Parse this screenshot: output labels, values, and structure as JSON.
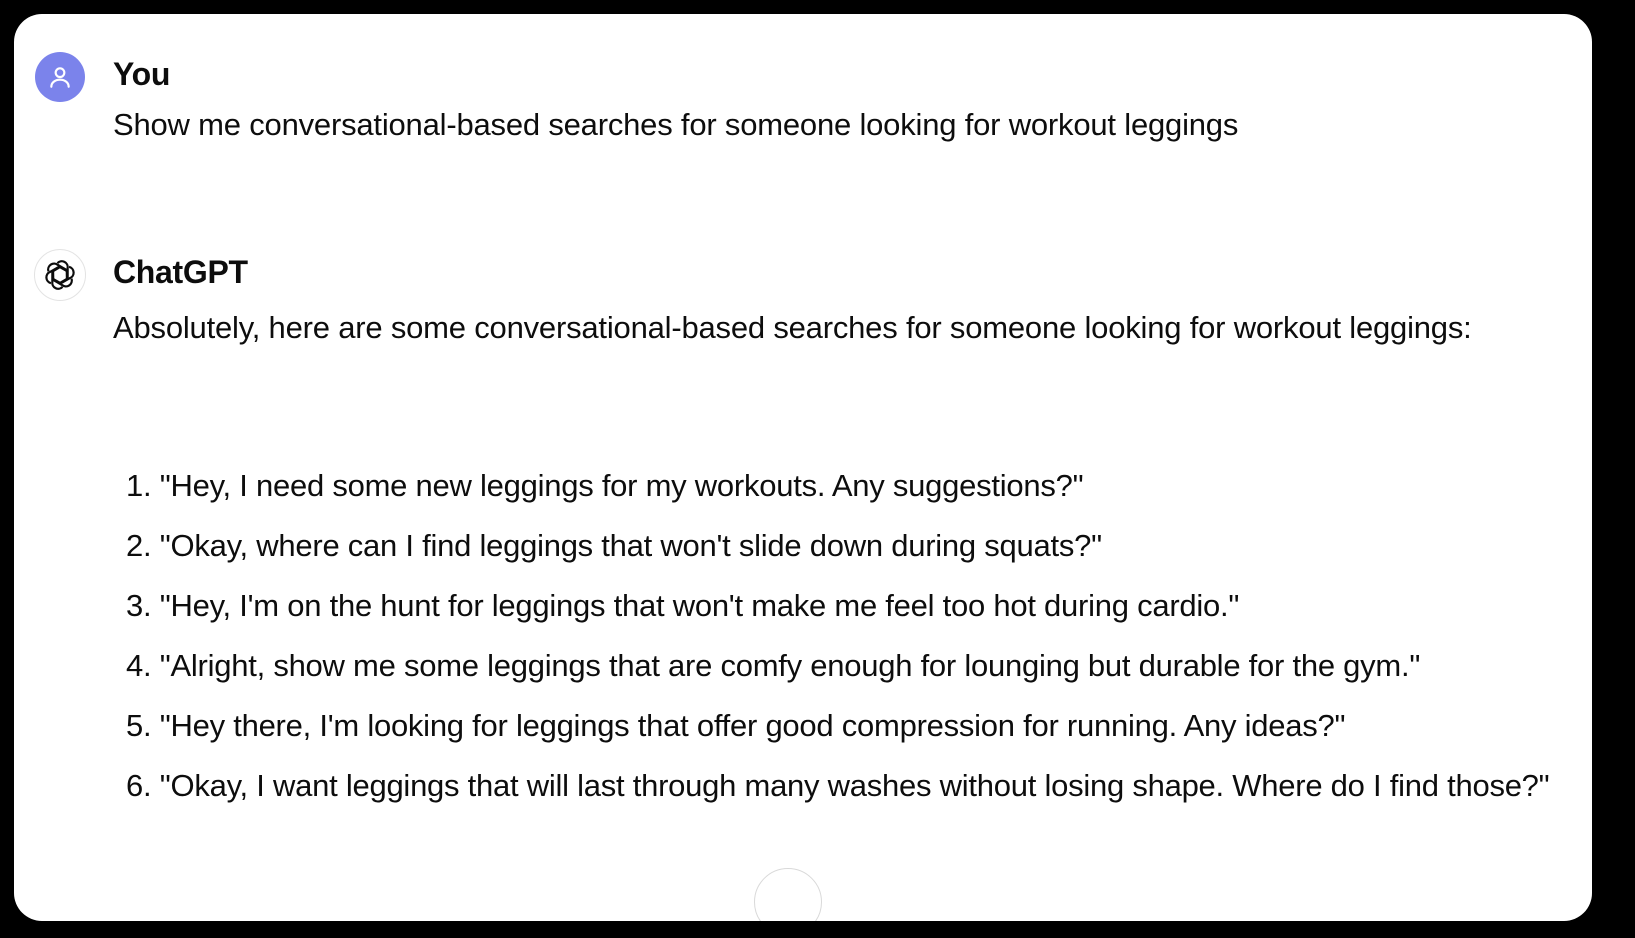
{
  "conversation": {
    "user": {
      "author": "You",
      "avatar_icon": "user-icon",
      "avatar_color": "#7b83eb",
      "message": "Show me conversational-based searches for someone looking for workout leggings"
    },
    "assistant": {
      "author": "ChatGPT",
      "avatar_icon": "openai-logo-icon",
      "intro": "Absolutely, here are some conversational-based searches for someone looking for workout leggings:",
      "items": [
        "1. \"Hey, I need some new leggings for my workouts. Any suggestions?\"",
        "2. \"Okay, where can I find leggings that won't slide down during squats?\"",
        "3. \"Hey, I'm on the hunt for leggings that won't make me feel too hot during cardio.\"",
        "4. \"Alright, show me some leggings that are comfy enough for lounging but durable for the gym.\"",
        "5. \"Hey there, I'm looking for leggings that offer good compression for running. Any ideas?\"",
        "6. \"Okay, I want leggings that will last through many washes without losing shape. Where do I find those?\""
      ]
    }
  },
  "scroll_button": {
    "icon": "arrow-down-icon"
  }
}
